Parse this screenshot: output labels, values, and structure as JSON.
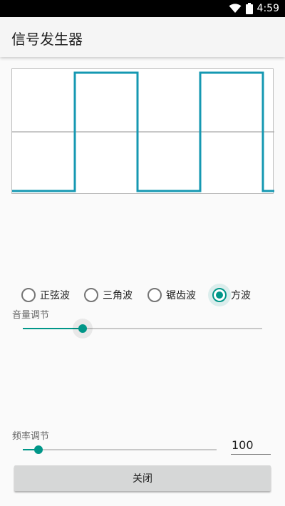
{
  "status_bar": {
    "time": "4:59"
  },
  "app_bar": {
    "title": "信号发生器"
  },
  "waveform": {
    "type": "square",
    "cycles": 2,
    "color": "#1598b2",
    "axis_color": "#a8a8a8"
  },
  "waveform_options": [
    {
      "label": "正弦波",
      "checked": false
    },
    {
      "label": "三角波",
      "checked": false
    },
    {
      "label": "锯齿波",
      "checked": false
    },
    {
      "label": "方波",
      "checked": true
    }
  ],
  "volume": {
    "label": "音量调节",
    "level": 0.25
  },
  "frequency": {
    "label": "频率调节",
    "value": "100",
    "level": 0.08
  },
  "close_button": {
    "label": "关闭"
  },
  "colors": {
    "accent": "#009688",
    "button_bg": "#d6d7d7"
  }
}
